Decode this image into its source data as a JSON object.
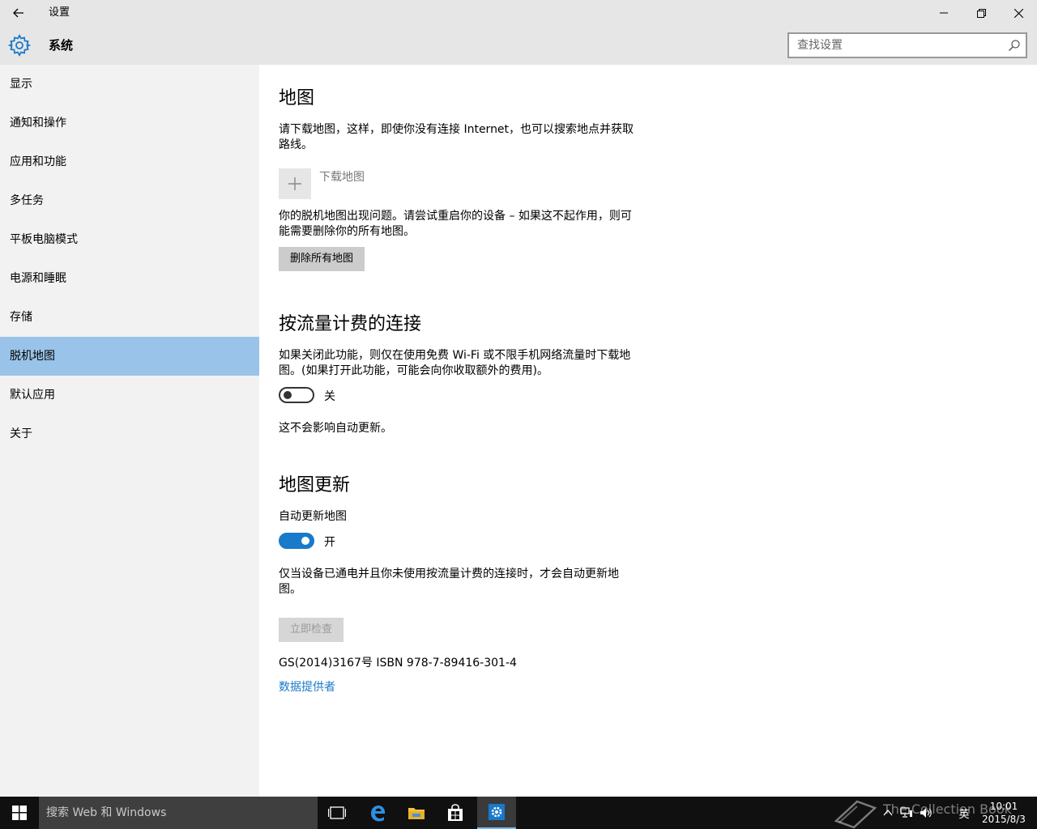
{
  "window": {
    "title": "设置",
    "section": "系统"
  },
  "search": {
    "placeholder": "查找设置"
  },
  "sidebar": {
    "items": [
      {
        "label": "显示"
      },
      {
        "label": "通知和操作"
      },
      {
        "label": "应用和功能"
      },
      {
        "label": "多任务"
      },
      {
        "label": "平板电脑模式"
      },
      {
        "label": "电源和睡眠"
      },
      {
        "label": "存储"
      },
      {
        "label": "脱机地图",
        "selected": true
      },
      {
        "label": "默认应用"
      },
      {
        "label": "关于"
      }
    ]
  },
  "maps": {
    "heading": "地图",
    "description": "请下载地图，这样，即使你没有连接 Internet，也可以搜索地点并获取路线。",
    "download_label": "下载地图",
    "error_text": "你的脱机地图出现问题。请尝试重启你的设备 – 如果这不起作用，则可能需要删除你的所有地图。",
    "delete_button": "删除所有地图"
  },
  "metered": {
    "heading": "按流量计费的连接",
    "description": "如果关闭此功能，则仅在使用免费 Wi-Fi 或不限手机网络流量时下载地图。(如果打开此功能，可能会向你收取额外的费用)。",
    "toggle_state": "关",
    "note": "这不会影响自动更新。"
  },
  "updates": {
    "heading": "地图更新",
    "auto_label": "自动更新地图",
    "toggle_state": "开",
    "description": "仅当设备已通电并且你未使用按流量计费的连接时，才会自动更新地图。",
    "check_button": "立即检查"
  },
  "footer": {
    "license": "GS(2014)3167号 ISBN 978-7-89416-301-4",
    "provider_link": "数据提供者"
  },
  "taskbar": {
    "search_text": "搜索 Web 和 Windows",
    "tray_lang": "英",
    "time": "10:01",
    "date": "2015/8/3",
    "watermark": "The Collection Book"
  },
  "colors": {
    "accent": "#1979ca",
    "selected_nav": "#99c3e8"
  }
}
